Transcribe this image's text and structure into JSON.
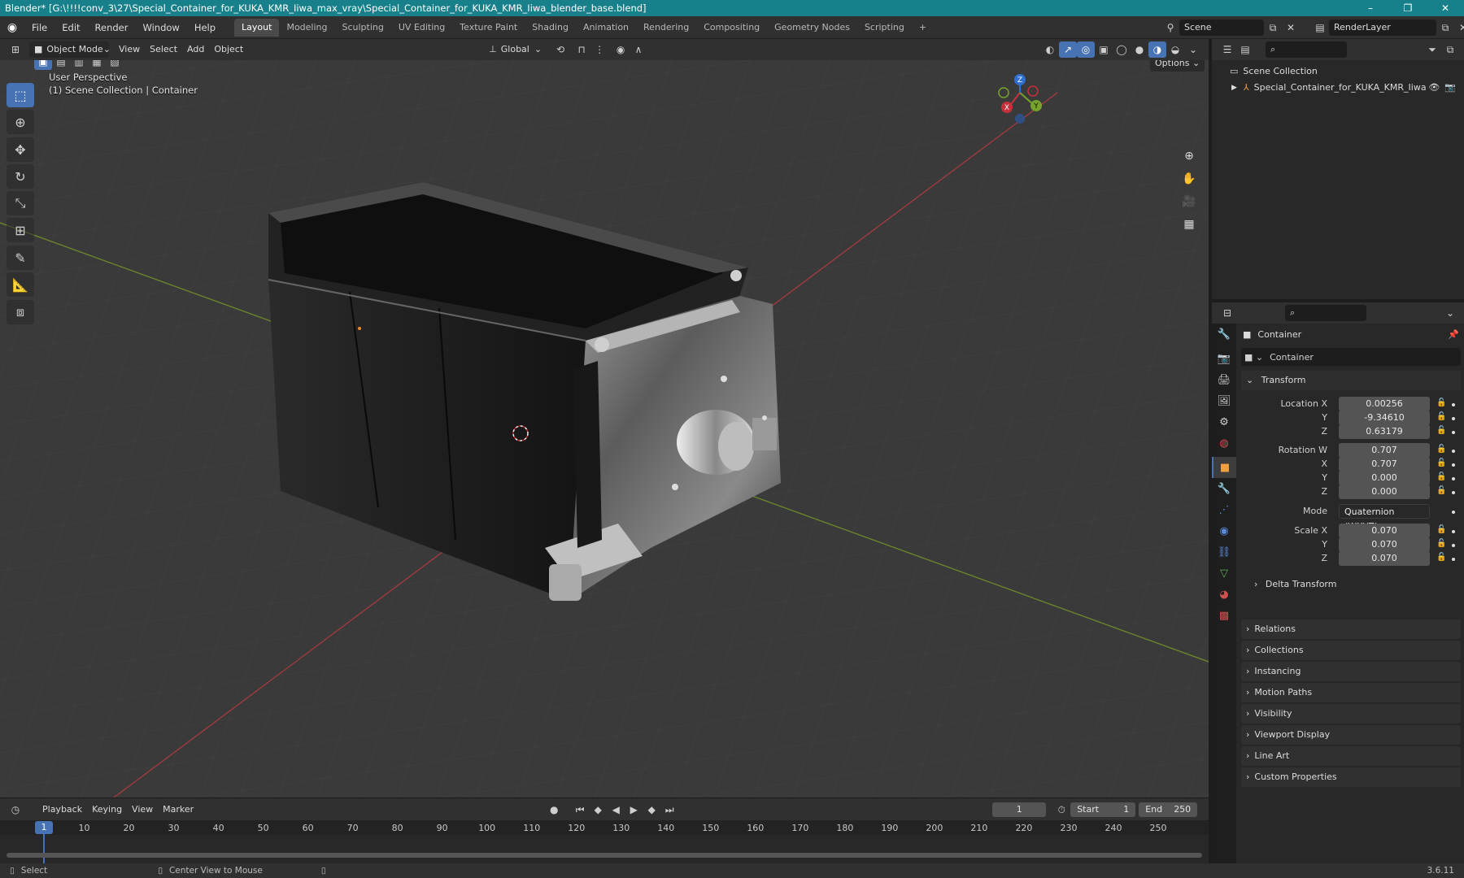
{
  "window": {
    "title": "Blender* [G:\\!!!!conv_3\\27\\Special_Container_for_KUKA_KMR_Iiwa_max_vray\\Special_Container_for_KUKA_KMR_Iiwa_blender_base.blend]",
    "minimize": "–",
    "maximize": "❐",
    "close": "✕"
  },
  "menu": [
    "File",
    "Edit",
    "Render",
    "Window",
    "Help"
  ],
  "workspaces": [
    "Layout",
    "Modeling",
    "Sculpting",
    "UV Editing",
    "Texture Paint",
    "Shading",
    "Animation",
    "Rendering",
    "Compositing",
    "Geometry Nodes",
    "Scripting"
  ],
  "active_workspace": "Layout",
  "scene": {
    "name": "Scene",
    "view_layer": "RenderLayer"
  },
  "viewport_header": {
    "mode": "Object Mode",
    "menus": [
      "View",
      "Select",
      "Add",
      "Object"
    ],
    "orientation": "Global",
    "options": "Options"
  },
  "viewport": {
    "perspective": "User Perspective",
    "collection_info": "(1) Scene Collection | Container",
    "gizmo": {
      "x": "X",
      "y": "Y",
      "z": "Z"
    }
  },
  "outliner": {
    "root": "Scene Collection",
    "items": [
      {
        "label": "Special_Container_for_KUKA_KMR_Iiwa"
      }
    ]
  },
  "properties": {
    "object_name": "Container",
    "data_name": "Container",
    "transform_label": "Transform",
    "location": {
      "label": "Location X",
      "x": "0.00256",
      "y": "-9.34610",
      "z": "0.63179"
    },
    "rotation": {
      "label": "Rotation W",
      "w": "0.707",
      "x": "0.707",
      "y": "0.000",
      "z": "0.000"
    },
    "mode": {
      "label": "Mode",
      "value": "Quaternion (WXYZ)"
    },
    "scale": {
      "label": "Scale X",
      "x": "0.070",
      "y": "0.070",
      "z": "0.070"
    },
    "axis_labels": {
      "y": "Y",
      "z": "Z",
      "x": "X"
    },
    "subpanels": [
      "Delta Transform"
    ],
    "panels": [
      "Relations",
      "Collections",
      "Instancing",
      "Motion Paths",
      "Visibility",
      "Viewport Display",
      "Line Art",
      "Custom Properties"
    ]
  },
  "timeline": {
    "menus": [
      "Playback",
      "Keying",
      "View",
      "Marker"
    ],
    "current_frame": "1",
    "start_label": "Start",
    "start": "1",
    "end_label": "End",
    "end": "250",
    "ticks": [
      "1",
      "10",
      "20",
      "30",
      "40",
      "50",
      "60",
      "70",
      "80",
      "90",
      "100",
      "110",
      "120",
      "130",
      "140",
      "150",
      "160",
      "170",
      "180",
      "190",
      "200",
      "210",
      "220",
      "230",
      "240",
      "250"
    ]
  },
  "statusbar": {
    "select": "Select",
    "center_view": "Center View to Mouse",
    "version": "3.6.11"
  },
  "colors": {
    "titlebar": "#17808a",
    "accent": "#4772b3",
    "axis_x": "#c8303c",
    "axis_y": "#76a32a",
    "axis_z": "#2f6fcf"
  }
}
